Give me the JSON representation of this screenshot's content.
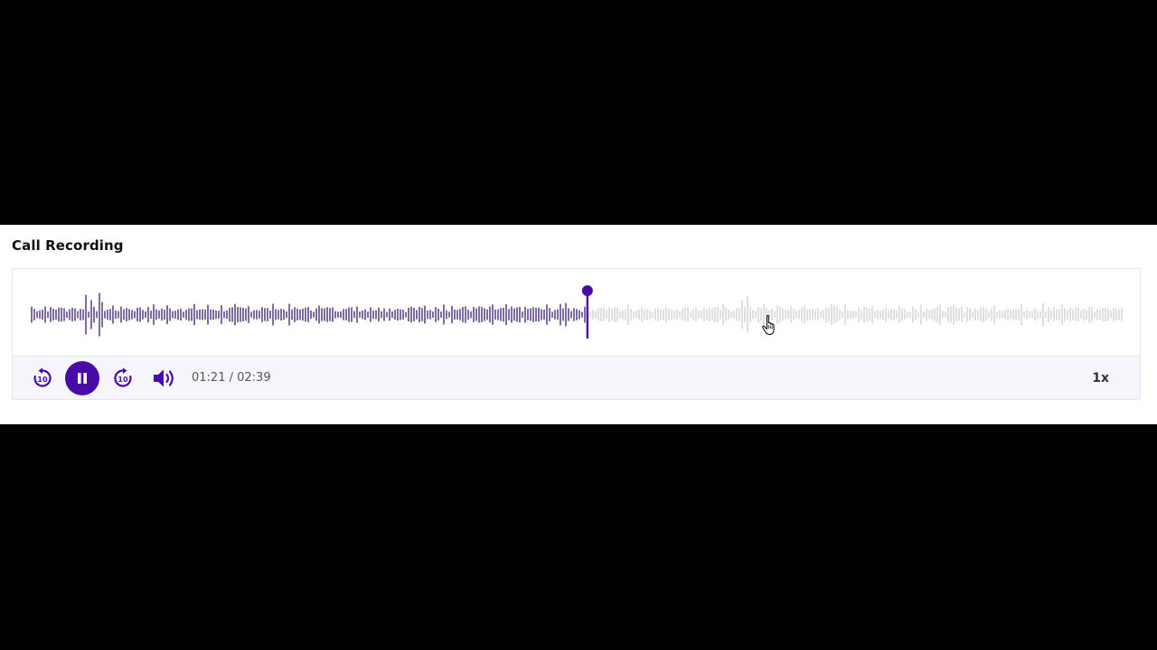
{
  "section": {
    "title": "Call Recording"
  },
  "player": {
    "current_time": "01:21",
    "separator": " / ",
    "duration": "02:39",
    "progress_fraction": 0.509,
    "speed_label": "1x",
    "skip_back_label": "10",
    "skip_forward_label": "10",
    "state": "playing"
  },
  "icons": {
    "rewind": "rewind-10-icon",
    "pause": "pause-icon",
    "forward": "forward-10-icon",
    "volume": "volume-icon",
    "pointer": "hand-pointer-icon"
  },
  "colors": {
    "accent": "#4a0aa8",
    "played": "#2a0a5e",
    "unplayed": "#c9c9d0",
    "controls_bg": "#f6f5fb"
  }
}
